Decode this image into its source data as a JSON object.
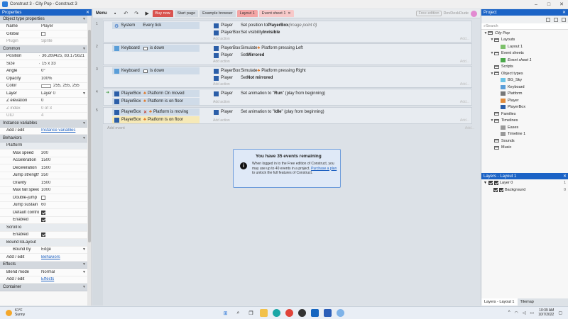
{
  "window": {
    "title": "Construct 3 - City Pop - Construct 3"
  },
  "properties": {
    "header": "Properties",
    "sections": [
      {
        "type": "section",
        "label": "Object type properties"
      },
      {
        "type": "row",
        "key": "Name",
        "value": "Player"
      },
      {
        "type": "row",
        "key": "Global",
        "check": false
      },
      {
        "type": "row",
        "key": "Plugin",
        "value": "Sprite",
        "dim": true
      },
      {
        "type": "section",
        "label": "Common"
      },
      {
        "type": "row",
        "key": "Position",
        "value": "36.269425, 83.175621",
        "tri": true
      },
      {
        "type": "row",
        "key": "Size",
        "value": "15 x 33",
        "tri": true
      },
      {
        "type": "row",
        "key": "Angle",
        "value": "0°"
      },
      {
        "type": "row",
        "key": "Opacity",
        "value": "100%"
      },
      {
        "type": "row",
        "key": "Color",
        "value": "255, 255, 255",
        "swatch": true
      },
      {
        "type": "row",
        "key": "Layer",
        "value": "Layer 0",
        "dropdown": true
      },
      {
        "type": "row",
        "key": "Z elevation",
        "value": "0"
      },
      {
        "type": "row",
        "key": "Z index",
        "value": "0 of 3",
        "dim": true
      },
      {
        "type": "row",
        "key": "UID",
        "value": "4",
        "dim": true
      },
      {
        "type": "section",
        "label": "Instance variables"
      },
      {
        "type": "row",
        "key": "Add / edit",
        "link": "Instance variables",
        "flush": true
      },
      {
        "type": "section",
        "label": "Behaviors"
      },
      {
        "type": "sub",
        "label": "Platform"
      },
      {
        "type": "row",
        "key": "Max speed",
        "value": "300",
        "indent": true
      },
      {
        "type": "row",
        "key": "Acceleration",
        "value": "1500",
        "indent": true
      },
      {
        "type": "row",
        "key": "Deceleration",
        "value": "1500",
        "indent": true
      },
      {
        "type": "row",
        "key": "Jump strength",
        "value": "350",
        "indent": true
      },
      {
        "type": "row",
        "key": "Gravity",
        "value": "1500",
        "indent": true
      },
      {
        "type": "row",
        "key": "Max fall speed",
        "value": "1000",
        "indent": true
      },
      {
        "type": "row",
        "key": "Double-jump",
        "check": false,
        "indent": true
      },
      {
        "type": "row",
        "key": "Jump sustain",
        "value": "60",
        "indent": true
      },
      {
        "type": "row",
        "key": "Default controls",
        "check": true,
        "indent": true
      },
      {
        "type": "row",
        "key": "Enabled",
        "check": true,
        "indent": true
      },
      {
        "type": "sub",
        "label": "ScrollTo"
      },
      {
        "type": "row",
        "key": "Enabled",
        "check": true,
        "indent": true
      },
      {
        "type": "sub",
        "label": "BoundToLayout"
      },
      {
        "type": "row",
        "key": "Bound by",
        "value": "Edge",
        "dropdown": true,
        "indent": true
      },
      {
        "type": "row",
        "key": "Add / edit",
        "link": "Behaviors",
        "flush": true
      },
      {
        "type": "section",
        "label": "Effects"
      },
      {
        "type": "row",
        "key": "Blend mode",
        "value": "Normal",
        "dropdown": true
      },
      {
        "type": "row",
        "key": "Add / edit",
        "link": "Effects",
        "flush": true
      },
      {
        "type": "section",
        "label": "Container"
      }
    ]
  },
  "toolbar": {
    "menu": "Menu",
    "buy_now": "Buy now",
    "tabs": [
      "Start page",
      "Example browser",
      "Layout 1",
      "Event sheet 1"
    ],
    "free_edition": "Free edition",
    "user": "DevDeskDude"
  },
  "events": {
    "add_action": "Add action",
    "add_event": "Add event",
    "add_right": "Add...",
    "list": [
      {
        "num": "1",
        "conditions": [
          {
            "obj": "System",
            "text": "Every tick"
          }
        ],
        "actions": [
          {
            "obj": "Player",
            "pre": "Set position to ",
            "bold": "PlayerBox",
            "post": " (image point 0)"
          },
          {
            "obj": "PlayerBox",
            "pre": "Set visibility ",
            "bold": "Invisible",
            "post": ""
          }
        ]
      },
      {
        "num": "2",
        "conditions": [
          {
            "obj": "Keyboard",
            "text": "is down"
          }
        ],
        "actions": [
          {
            "obj": "PlayerBox",
            "pre": "Simulate ",
            "plat": "Platform pressing Left",
            "bold": "",
            "post": ""
          },
          {
            "obj": "Player",
            "pre": "Set ",
            "bold": "Mirrored",
            "post": ""
          }
        ]
      },
      {
        "num": "3",
        "conditions": [
          {
            "obj": "Keyboard",
            "text": "is down"
          }
        ],
        "actions": [
          {
            "obj": "PlayerBox",
            "pre": "Simulate ",
            "plat": "Platform pressing Right",
            "bold": "",
            "post": ""
          },
          {
            "obj": "Player",
            "pre": "Set ",
            "bold": "Not mirrored",
            "post": ""
          }
        ]
      },
      {
        "num": "4",
        "conditions": [
          {
            "obj": "PlayerBox",
            "text": "Platform On moved"
          },
          {
            "obj": "PlayerBox",
            "text": "Platform is on floor"
          }
        ],
        "actions": [
          {
            "obj": "Player",
            "pre": "Set animation to \"",
            "bold": "Run",
            "post": "\" (play from beginning)"
          }
        ]
      },
      {
        "num": "5",
        "conditions": [
          {
            "obj": "PlayerBox",
            "text": "Platform is moving"
          },
          {
            "obj": "PlayerBox",
            "text": "Platform is on floor"
          }
        ],
        "actions": [
          {
            "obj": "Player",
            "pre": "Set animation to \"",
            "bold": "Idle",
            "post": "\" (play from beginning)"
          }
        ]
      }
    ]
  },
  "notice": {
    "title": "You have 35 events remaining",
    "line1": "When logged in to the Free edition of Construct, you may use up to 40 events in a project.",
    "link": "Purchase a plan",
    "line2": " to unlock the full features of Construct."
  },
  "project": {
    "header": "Project",
    "search": "Search",
    "tree": [
      {
        "label": "City Pop",
        "italic": true,
        "depth": 0,
        "tw": "▼"
      },
      {
        "label": "Layouts",
        "depth": 1,
        "tw": "▼"
      },
      {
        "label": "Layout 1",
        "depth": 2,
        "tw": ""
      },
      {
        "label": "Event sheets",
        "depth": 1,
        "tw": "▼"
      },
      {
        "label": "Event sheet 1",
        "italic": true,
        "depth": 2,
        "tw": ""
      },
      {
        "label": "Scripts",
        "depth": 1,
        "tw": ""
      },
      {
        "label": "Object types",
        "depth": 1,
        "tw": "▼"
      },
      {
        "label": "BG_Sky",
        "depth": 2,
        "tw": ""
      },
      {
        "label": "Keyboard",
        "depth": 2,
        "tw": ""
      },
      {
        "label": "Platform",
        "depth": 2,
        "tw": ""
      },
      {
        "label": "Player",
        "depth": 2,
        "tw": ""
      },
      {
        "label": "PlayerBox",
        "depth": 2,
        "tw": ""
      },
      {
        "label": "Families",
        "depth": 1,
        "tw": ""
      },
      {
        "label": "Timelines",
        "depth": 1,
        "tw": "▼"
      },
      {
        "label": "Eases",
        "depth": 2,
        "tw": ""
      },
      {
        "label": "Timeline 1",
        "depth": 2,
        "tw": ""
      },
      {
        "label": "Sounds",
        "depth": 1,
        "tw": ""
      },
      {
        "label": "Music",
        "depth": 1,
        "tw": ""
      }
    ]
  },
  "layers": {
    "header": "Layers - Layout 1",
    "rows": [
      {
        "label": "Layer 0",
        "n": "1",
        "depth": 0
      },
      {
        "label": "Background",
        "n": "0",
        "depth": 1
      }
    ],
    "tabs": [
      "Layers - Layout 1",
      "Tilemap"
    ]
  },
  "taskbar": {
    "temp": "61°F",
    "cond": "Sunny",
    "time": "10:39 AM",
    "date": "10/7/2022"
  },
  "colors": {
    "accent": "#1b63c6",
    "buy": "#d9534f",
    "platform": "#e0731f"
  }
}
